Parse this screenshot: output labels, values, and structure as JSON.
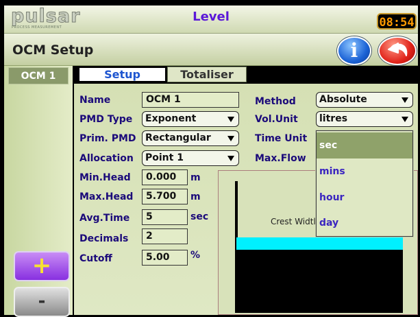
{
  "topbar": {
    "logo_text": "pulsar",
    "logo_sub": "PROCESS MEASUREMENT",
    "screen_title": "Level",
    "clock": "08:54"
  },
  "header": {
    "title": "OCM Setup",
    "info_icon": "info-icon",
    "back_icon": "back-arrow-icon"
  },
  "sidebar": {
    "selected_item": "OCM 1",
    "add_label": "+",
    "remove_label": "-"
  },
  "tabs": [
    {
      "label": "Setup",
      "active": true
    },
    {
      "label": "Totaliser",
      "active": false
    }
  ],
  "left_fields": {
    "name": {
      "label": "Name",
      "value": "OCM 1"
    },
    "pmd_type": {
      "label": "PMD Type",
      "value": "Exponent"
    },
    "prim_pmd": {
      "label": "Prim. PMD",
      "value": "Rectangular"
    },
    "allocation": {
      "label": "Allocation",
      "value": "Point 1"
    },
    "min_head": {
      "label": "Min.Head",
      "value": "0.000",
      "unit": "m"
    },
    "max_head": {
      "label": "Max.Head",
      "value": "5.700",
      "unit": "m"
    },
    "avg_time": {
      "label": "Avg.Time",
      "value": "5",
      "unit": "sec"
    },
    "decimals": {
      "label": "Decimals",
      "value": "2"
    },
    "cutoff": {
      "label": "Cutoff",
      "value": "5.00",
      "unit": "%"
    }
  },
  "right_fields": {
    "method": {
      "label": "Method",
      "value": "Absolute"
    },
    "vol_unit": {
      "label": "Vol.Unit",
      "value": "litres"
    },
    "time_unit": {
      "label": "Time Unit"
    },
    "max_flow": {
      "label": "Max.Flow"
    }
  },
  "time_unit_options": [
    {
      "label": "sec",
      "selected": true
    },
    {
      "label": "mins",
      "selected": false
    },
    {
      "label": "hour",
      "selected": false
    },
    {
      "label": "day",
      "selected": false
    }
  ],
  "drawing": {
    "crest_label": "Crest Widtl"
  },
  "colors": {
    "accent_purple": "#5b18d8",
    "water": "#00f0ff",
    "selected_option": "#8fa26a"
  }
}
